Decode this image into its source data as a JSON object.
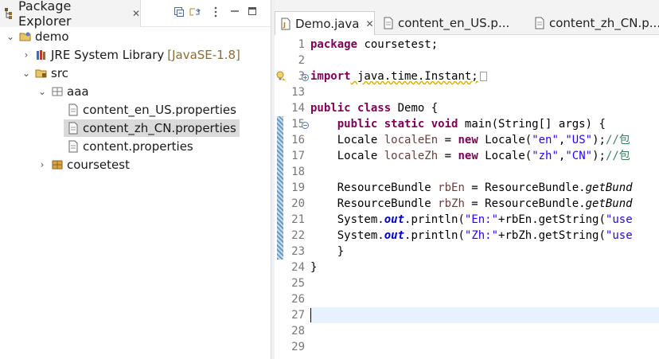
{
  "package_explorer": {
    "title": "Package Explorer",
    "close_glyph": "✕",
    "toolbar": [
      "collapse-all-icon",
      "link-with-editor-icon",
      "view-menu-icon",
      "minimize-icon",
      "maximize-icon"
    ],
    "tree": [
      {
        "label": "demo",
        "icon": "java-project-icon",
        "twisty": "expanded"
      },
      {
        "label": "JRE System Library",
        "decoration": "[JavaSE-1.8]",
        "icon": "library-icon",
        "twisty": "collapsed"
      },
      {
        "label": "src",
        "icon": "source-folder-icon",
        "twisty": "expanded"
      },
      {
        "label": "aaa",
        "icon": "package-icon",
        "twisty": "expanded"
      },
      {
        "label": "content_en_US.properties",
        "icon": "file-icon"
      },
      {
        "label": "content_zh_CN.properties",
        "icon": "file-icon",
        "selected": true
      },
      {
        "label": "content.properties",
        "icon": "file-icon"
      },
      {
        "label": "coursetest",
        "icon": "package-icon",
        "twisty": "collapsed"
      }
    ]
  },
  "editor": {
    "tabs": [
      {
        "label": "Demo.java",
        "active": true,
        "icon": "java-file-icon",
        "close": "✕"
      },
      {
        "label": "content_en_US.p...",
        "icon": "file-icon"
      },
      {
        "label": "content_zh_CN.p...",
        "icon": "file-icon"
      }
    ],
    "line_numbers": [
      "1",
      "2",
      "3",
      "13",
      "14",
      "15",
      "16",
      "17",
      "18",
      "19",
      "20",
      "21",
      "22",
      "23",
      "24",
      "25",
      "26",
      "27",
      "28",
      "29"
    ],
    "code": {
      "l1_kw": "package",
      "l1_rest": " coursetest;",
      "l3_kw": "import",
      "l3_rest": " java.time.Instant;",
      "l14_kw1": "public",
      "l14_kw2": "class",
      "l14_rest": " Demo {",
      "l15_kw1": "public",
      "l15_kw2": "static",
      "l15_kw3": "void",
      "l15_rest": " main(String[] args) {",
      "l16_a": "Locale ",
      "l16_var": "localeEn",
      "l16_b": " = ",
      "l16_new": "new",
      "l16_c": " Locale(",
      "l16_s1": "\"en\"",
      "l16_d": ",",
      "l16_s2": "\"US\"",
      "l16_e": ");",
      "l16_cmt": "//包",
      "l17_a": "Locale ",
      "l17_var": "localeZh",
      "l17_b": " = ",
      "l17_new": "new",
      "l17_c": " Locale(",
      "l17_s1": "\"zh\"",
      "l17_d": ",",
      "l17_s2": "\"CN\"",
      "l17_e": ");",
      "l17_cmt": "//包",
      "l19_a": "ResourceBundle ",
      "l19_var": "rbEn",
      "l19_b": " = ResourceBundle.",
      "l19_m": "getBund",
      "l20_a": "ResourceBundle ",
      "l20_var": "rbZh",
      "l20_b": " = ResourceBundle.",
      "l20_m": "getBund",
      "l21_a": "System.",
      "l21_f": "out",
      "l21_b": ".println(",
      "l21_s": "\"En:\"",
      "l21_c": "+rbEn.getString(",
      "l21_s2": "\"use",
      "l22_a": "System.",
      "l22_f": "out",
      "l22_b": ".println(",
      "l22_s": "\"Zh:\"",
      "l22_c": "+rbZh.getString(",
      "l22_s2": "\"use",
      "l23": "}",
      "l24": "}"
    }
  }
}
